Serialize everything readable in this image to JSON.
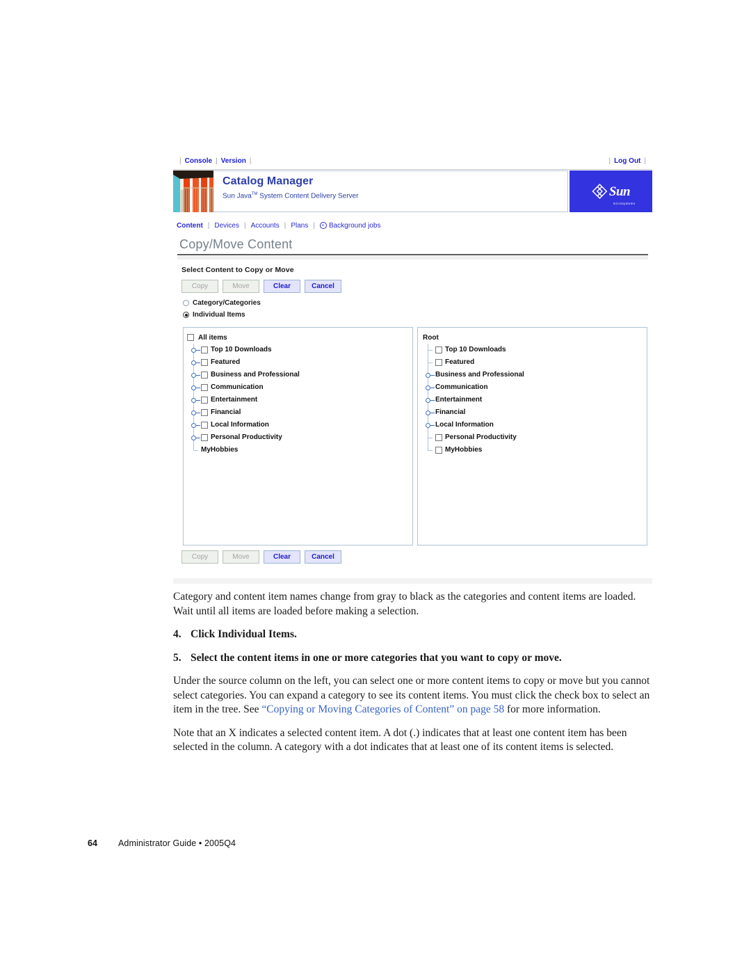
{
  "app": {
    "utility_bar": {
      "left_links": [
        "Console",
        "Version"
      ],
      "right_links": [
        "Log Out"
      ]
    },
    "masthead": {
      "title": "Catalog Manager",
      "subtitle_before": "Sun Java",
      "subtitle_tm": "TM",
      "subtitle_after": " System Content Delivery Server",
      "logo_text": "Sun",
      "logo_subtext": "microsystems",
      "logo_bg": "#3333e0",
      "thumbnail_name": "catalog-books-thumbnail"
    },
    "nav": {
      "items": [
        {
          "label": "Content",
          "active": true,
          "icon": ""
        },
        {
          "label": "Devices",
          "active": false,
          "icon": ""
        },
        {
          "label": "Accounts",
          "active": false,
          "icon": ""
        },
        {
          "label": "Plans",
          "active": false,
          "icon": ""
        },
        {
          "label": "Background jobs",
          "active": false,
          "icon": "clock-icon"
        }
      ]
    },
    "page_title": "Copy/Move Content",
    "section_heading": "Select Content to Copy or Move",
    "buttons": [
      {
        "label": "Copy",
        "state": "disabled"
      },
      {
        "label": "Move",
        "state": "disabled"
      },
      {
        "label": "Clear",
        "state": "enabled"
      },
      {
        "label": "Cancel",
        "state": "enabled"
      }
    ],
    "radios": [
      {
        "label": "Category/Categories",
        "checked": false
      },
      {
        "label": "Individual Items",
        "checked": true
      }
    ],
    "source_panel": {
      "root_label": "All items",
      "root_has_checkbox": true,
      "items": [
        {
          "label": "Top 10 Downloads",
          "checkbox": true,
          "handle": true
        },
        {
          "label": "Featured",
          "checkbox": true,
          "handle": true
        },
        {
          "label": "Business and Professional",
          "checkbox": true,
          "handle": true
        },
        {
          "label": "Communication",
          "checkbox": true,
          "handle": true
        },
        {
          "label": "Entertainment",
          "checkbox": true,
          "handle": true
        },
        {
          "label": "Financial",
          "checkbox": true,
          "handle": true
        },
        {
          "label": "Local Information",
          "checkbox": true,
          "handle": true
        },
        {
          "label": "Personal Productivity",
          "checkbox": true,
          "handle": true
        },
        {
          "label": "MyHobbies",
          "checkbox": false,
          "handle": false
        }
      ]
    },
    "target_panel": {
      "root_label": "Root",
      "root_has_checkbox": false,
      "items": [
        {
          "label": "Top 10 Downloads",
          "checkbox": true,
          "handle": false
        },
        {
          "label": "Featured",
          "checkbox": true,
          "handle": false
        },
        {
          "label": "Business and Professional",
          "checkbox": false,
          "handle": true
        },
        {
          "label": "Communication",
          "checkbox": false,
          "handle": true
        },
        {
          "label": "Entertainment",
          "checkbox": false,
          "handle": true
        },
        {
          "label": "Financial",
          "checkbox": false,
          "handle": true
        },
        {
          "label": "Local Information",
          "checkbox": false,
          "handle": true
        },
        {
          "label": "Personal Productivity",
          "checkbox": true,
          "handle": false
        },
        {
          "label": "MyHobbies",
          "checkbox": true,
          "handle": false
        }
      ]
    }
  },
  "document": {
    "intro_paragraph": "Category and content item names change from gray to black as the categories and content items are loaded. Wait until all items are loaded before making a selection.",
    "steps": [
      {
        "number": "4.",
        "text": "Click Individual Items."
      },
      {
        "number": "5.",
        "text": "Select the content items in one or more categories that you want to copy or move."
      }
    ],
    "detail_paragraph_part1": "Under the source column on the left, you can select one or more content items to copy or move but you cannot select categories. You can expand a category to see its content items. You must click the check box to select an item in the tree. See ",
    "detail_xref": "“Copying or Moving Categories of Content” on page 58",
    "detail_paragraph_part2": " for more information.",
    "note_paragraph": "Note that an X indicates a selected content item. A dot (.) indicates that at least one content item has been selected in the column. A category with a dot indicates that at least one of its content items is selected."
  },
  "footer": {
    "page_number": "64",
    "text": "Administrator Guide  •  2005Q4"
  }
}
